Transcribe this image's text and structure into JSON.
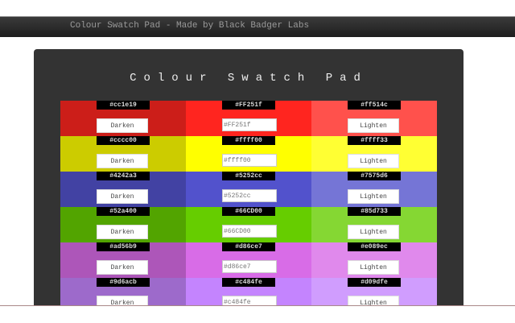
{
  "topbar": {
    "title": "Colour Swatch Pad - Made by Black Badger Labs"
  },
  "panel": {
    "title": "Colour Swatch Pad"
  },
  "labels": {
    "darken": "Darken",
    "lighten": "Lighten"
  },
  "rows": [
    {
      "dark": "#cc1e19",
      "base": "#FF251f",
      "light": "#ff514c"
    },
    {
      "dark": "#cccc00",
      "base": "#ffff00",
      "light": "#ffff33"
    },
    {
      "dark": "#4242a3",
      "base": "#5252cc",
      "light": "#7575d6"
    },
    {
      "dark": "#52a400",
      "base": "#66CD00",
      "light": "#85d733"
    },
    {
      "dark": "#ad56b9",
      "base": "#d86ce7",
      "light": "#e089ec"
    },
    {
      "dark": "#9d6acb",
      "base": "#c484fe",
      "light": "#d09dfe"
    }
  ]
}
